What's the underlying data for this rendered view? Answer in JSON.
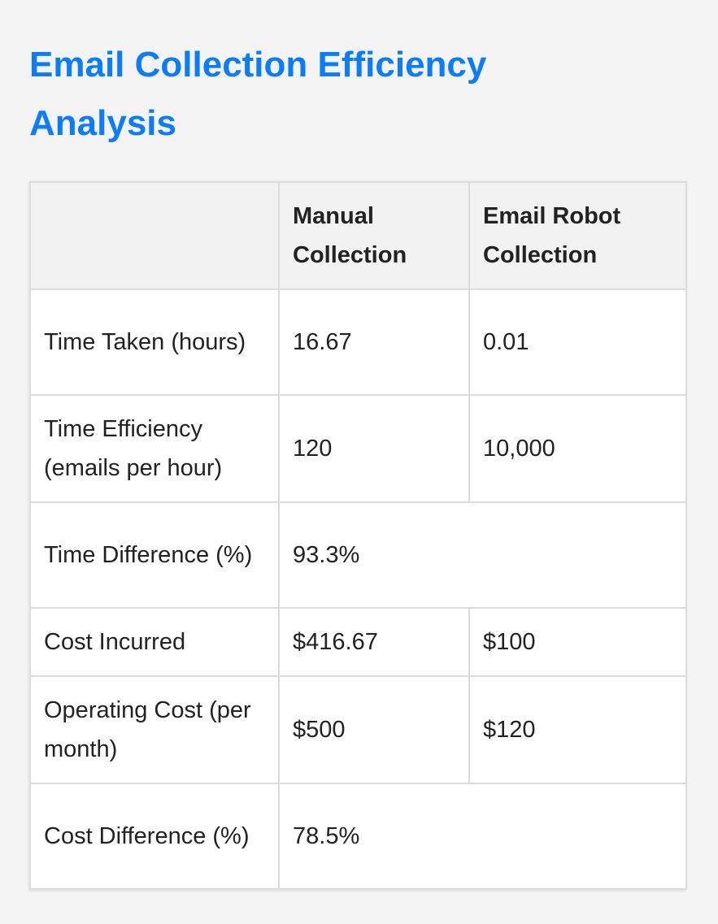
{
  "page": {
    "title": "Email Collection Efficiency Analysis"
  },
  "table": {
    "headers": [
      "",
      "Manual Collection",
      "Email Robot Collection"
    ],
    "rows": [
      {
        "label": "Time Taken (hours)",
        "manual": "16.67",
        "robot": "0.01"
      },
      {
        "label": "Time Efficiency (emails per hour)",
        "manual": "120",
        "robot": "10,000"
      },
      {
        "label": "Time Difference (%)",
        "combined": "93.3%"
      },
      {
        "label": "Cost Incurred",
        "manual": "$416.67",
        "robot": "$100"
      },
      {
        "label": "Operating Cost (per month)",
        "manual": "$500",
        "robot": "$120"
      },
      {
        "label": "Cost Difference (%)",
        "combined": "78.5%"
      }
    ]
  },
  "colors": {
    "title": "#0a7cff",
    "header_bg": "#f2f2f2",
    "border": "#dcdcdc",
    "page_bg": "#f4f4f4"
  }
}
